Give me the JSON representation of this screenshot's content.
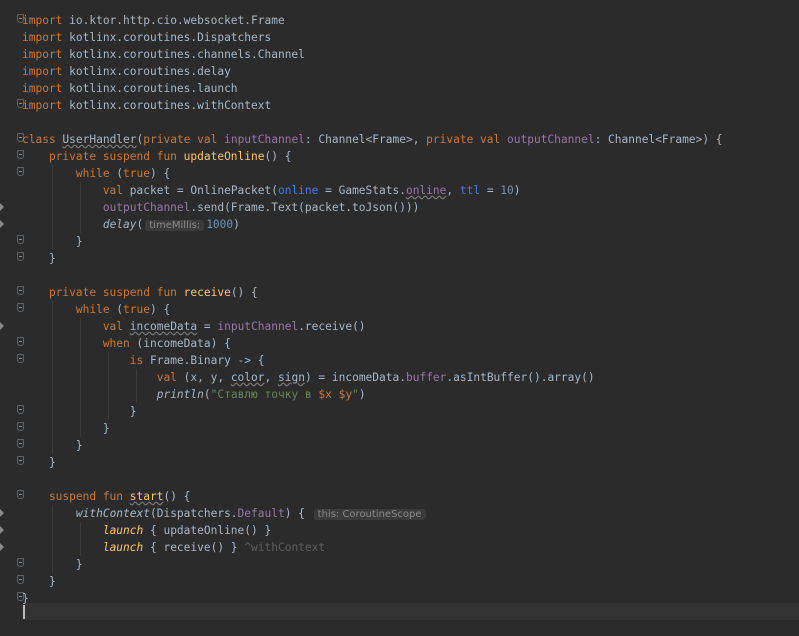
{
  "editor": {
    "language": "kotlin",
    "lines": [
      [
        {
          "t": "import ",
          "c": "kw"
        },
        {
          "t": "io.ktor.http.cio.websocket.Frame",
          "c": ""
        }
      ],
      [
        {
          "t": "import ",
          "c": "kw"
        },
        {
          "t": "kotlinx.coroutines.Dispatchers",
          "c": ""
        }
      ],
      [
        {
          "t": "import ",
          "c": "kw"
        },
        {
          "t": "kotlinx.coroutines.channels.Channel",
          "c": ""
        }
      ],
      [
        {
          "t": "import ",
          "c": "kw"
        },
        {
          "t": "kotlinx.coroutines.delay",
          "c": ""
        }
      ],
      [
        {
          "t": "import ",
          "c": "kw"
        },
        {
          "t": "kotlinx.coroutines.launch",
          "c": ""
        }
      ],
      [
        {
          "t": "import ",
          "c": "kw"
        },
        {
          "t": "kotlinx.coroutines.withContext",
          "c": ""
        }
      ],
      [],
      [
        {
          "t": "class ",
          "c": "kw"
        },
        {
          "t": "UserHandler",
          "c": "und"
        },
        {
          "t": "(",
          "c": ""
        },
        {
          "t": "private val ",
          "c": "kw"
        },
        {
          "t": "inputChannel",
          "c": "prop"
        },
        {
          "t": ": Channel<Frame>, ",
          "c": ""
        },
        {
          "t": "private val ",
          "c": "kw"
        },
        {
          "t": "outputChannel",
          "c": "prop"
        },
        {
          "t": ": Channel<Frame>) {",
          "c": ""
        }
      ],
      [
        {
          "t": "    private suspend fun ",
          "c": "kw"
        },
        {
          "t": "updateOnline",
          "c": "fn"
        },
        {
          "t": "() {",
          "c": ""
        }
      ],
      [
        {
          "t": "        while ",
          "c": "kw"
        },
        {
          "t": "(",
          "c": ""
        },
        {
          "t": "true",
          "c": "kw"
        },
        {
          "t": ") {",
          "c": ""
        }
      ],
      [
        {
          "t": "            val ",
          "c": "kw"
        },
        {
          "t": "packet = OnlinePacket(",
          "c": ""
        },
        {
          "t": "online",
          "c": "named"
        },
        {
          "t": " = GameStats.",
          "c": ""
        },
        {
          "t": "online",
          "c": "prop und"
        },
        {
          "t": ", ",
          "c": ""
        },
        {
          "t": "ttl",
          "c": "named"
        },
        {
          "t": " = ",
          "c": ""
        },
        {
          "t": "10",
          "c": "num"
        },
        {
          "t": ")",
          "c": ""
        }
      ],
      [
        {
          "t": "            ",
          "c": ""
        },
        {
          "t": "outputChannel",
          "c": "prop"
        },
        {
          "t": ".send(Frame.Text(packet.toJson()))",
          "c": ""
        }
      ],
      [
        {
          "t": "            ",
          "c": ""
        },
        {
          "t": "delay",
          "c": "ital"
        },
        {
          "t": "(",
          "c": ""
        },
        {
          "t": "timeMillis:",
          "c": "hint"
        },
        {
          "t": "1000",
          "c": "num"
        },
        {
          "t": ")",
          "c": ""
        }
      ],
      [
        {
          "t": "        }",
          "c": ""
        }
      ],
      [
        {
          "t": "    }",
          "c": ""
        }
      ],
      [],
      [
        {
          "t": "    private suspend fun ",
          "c": "kw"
        },
        {
          "t": "receive",
          "c": "fn"
        },
        {
          "t": "() {",
          "c": ""
        }
      ],
      [
        {
          "t": "        while ",
          "c": "kw"
        },
        {
          "t": "(",
          "c": ""
        },
        {
          "t": "true",
          "c": "kw"
        },
        {
          "t": ") {",
          "c": ""
        }
      ],
      [
        {
          "t": "            val ",
          "c": "kw"
        },
        {
          "t": "incomeData",
          "c": "und"
        },
        {
          "t": " = ",
          "c": ""
        },
        {
          "t": "inputChannel",
          "c": "prop"
        },
        {
          "t": ".receive()",
          "c": ""
        }
      ],
      [
        {
          "t": "            when ",
          "c": "kw"
        },
        {
          "t": "(incomeData) {",
          "c": ""
        }
      ],
      [
        {
          "t": "                is ",
          "c": "kw"
        },
        {
          "t": "Frame.Binary -> {",
          "c": ""
        }
      ],
      [
        {
          "t": "                    val ",
          "c": "kw"
        },
        {
          "t": "(x, y, ",
          "c": ""
        },
        {
          "t": "color",
          "c": "und"
        },
        {
          "t": ", ",
          "c": ""
        },
        {
          "t": "sign",
          "c": "und"
        },
        {
          "t": ") = incomeData.",
          "c": ""
        },
        {
          "t": "buffer",
          "c": "prop"
        },
        {
          "t": ".asIntBuffer().array()",
          "c": ""
        }
      ],
      [
        {
          "t": "                    ",
          "c": ""
        },
        {
          "t": "println",
          "c": "ital"
        },
        {
          "t": "(",
          "c": ""
        },
        {
          "t": "\"Ставлю точку в ",
          "c": "str"
        },
        {
          "t": "$x $y",
          "c": "kw"
        },
        {
          "t": "\"",
          "c": "str"
        },
        {
          "t": ")",
          "c": ""
        }
      ],
      [
        {
          "t": "                }",
          "c": ""
        }
      ],
      [
        {
          "t": "            }",
          "c": ""
        }
      ],
      [
        {
          "t": "        }",
          "c": ""
        }
      ],
      [
        {
          "t": "    }",
          "c": ""
        }
      ],
      [],
      [
        {
          "t": "    suspend fun ",
          "c": "kw"
        },
        {
          "t": "start",
          "c": "fn und"
        },
        {
          "t": "() {",
          "c": ""
        }
      ],
      [
        {
          "t": "        ",
          "c": ""
        },
        {
          "t": "withContext",
          "c": "ital"
        },
        {
          "t": "(Dispatchers.",
          "c": ""
        },
        {
          "t": "Default",
          "c": "prop"
        },
        {
          "t": ") { ",
          "c": ""
        },
        {
          "t": "this: CoroutineScope",
          "c": "hint"
        }
      ],
      [
        {
          "t": "            ",
          "c": ""
        },
        {
          "t": "launch",
          "c": "ext"
        },
        {
          "t": " { updateOnline() }",
          "c": ""
        }
      ],
      [
        {
          "t": "            ",
          "c": ""
        },
        {
          "t": "launch",
          "c": "ext"
        },
        {
          "t": " { receive() } ",
          "c": ""
        },
        {
          "t": "^withContext",
          "c": "ghost"
        }
      ],
      [
        {
          "t": "        }",
          "c": ""
        }
      ],
      [
        {
          "t": "    }",
          "c": ""
        }
      ],
      [
        {
          "t": "}",
          "c": ""
        }
      ]
    ]
  }
}
